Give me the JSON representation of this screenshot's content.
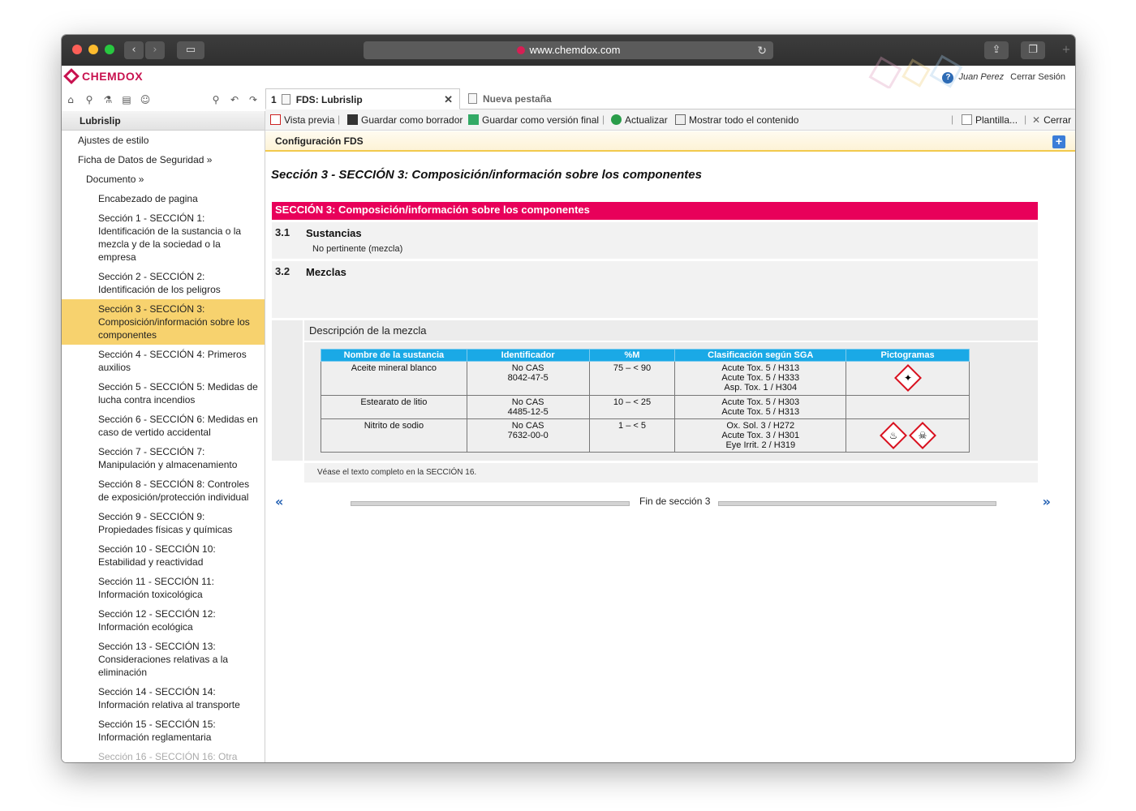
{
  "browser": {
    "url": "www.chemdox.com"
  },
  "app": {
    "logo": "CHEMDOX",
    "user": "Juan Perez",
    "logout": "Cerrar Sesión"
  },
  "tabs": [
    {
      "num": "1",
      "label": "FDS: Lubrislip",
      "close": "✕"
    },
    {
      "label": "Nueva pestaña"
    }
  ],
  "sidebar": {
    "title": "Lubrislip",
    "items": [
      "Ajustes de estilo",
      "Ficha de Datos de Seguridad »",
      "Documento »",
      "Encabezado de pagina",
      "Sección 1 - SECCIÓN 1: Identificación de la sustancia o la mezcla y de la sociedad o la empresa",
      "Sección 2 - SECCIÓN 2: Identificación de los peligros",
      "Sección 3 - SECCIÓN 3: Composición/información sobre los componentes",
      "Sección 4 - SECCIÓN 4: Primeros auxilios",
      "Sección 5 - SECCIÓN 5: Medidas de lucha contra incendios",
      "Sección 6 - SECCIÓN 6: Medidas en caso de vertido accidental",
      "Sección 7 - SECCIÓN 7: Manipulación y almacenamiento",
      "Sección 8 - SECCIÓN 8: Controles de exposición/protección individual",
      "Sección 9 - SECCIÓN 9: Propiedades físicas y químicas",
      "Sección 10 - SECCIÓN 10: Estabilidad y reactividad",
      "Sección 11 - SECCIÓN 11: Información toxicológica",
      "Sección 12 - SECCIÓN 12: Información ecológica",
      "Sección 13 - SECCIÓN 13: Consideraciones relativas a la eliminación",
      "Sección 14 - SECCIÓN 14: Información relativa al transporte",
      "Sección 15 - SECCIÓN 15: Información reglamentaria",
      "Sección 16 - SECCIÓN 16: Otra"
    ]
  },
  "toolbar": {
    "preview": "Vista previa",
    "save_draft": "Guardar como borrador",
    "save_final": "Guardar como versión final",
    "refresh": "Actualizar",
    "show_all": "Mostrar todo el contenido",
    "template": "Plantilla...",
    "close": "Cerrar"
  },
  "config": {
    "title": "Configuración FDS",
    "plus": "+"
  },
  "content": {
    "page_title": "Sección 3 - SECCIÓN 3: Composición/información sobre los componentes",
    "section_header": "SECCIÓN 3: Composición/información sobre los componentes",
    "sub1": {
      "num": "3.1",
      "title": "Sustancias",
      "text": "No pertinente (mezcla)"
    },
    "sub2": {
      "num": "3.2",
      "title": "Mezclas"
    },
    "mix_desc": "Descripción de la mezcla",
    "table": {
      "headers": [
        "Nombre de la sustancia",
        "Identificador",
        "%M",
        "Clasificación según SGA",
        "Pictogramas"
      ],
      "rows": [
        {
          "name": "Aceite mineral blanco",
          "id1": "No CAS",
          "id2": "8042-47-5",
          "pct": "75 – < 90",
          "cls1": "Acute Tox. 5 / H313",
          "cls2": "Acute Tox. 5 / H333",
          "cls3": "Asp. Tox. 1 / H304",
          "pictos": [
            "health-hazard"
          ]
        },
        {
          "name": "Estearato de litio",
          "id1": "No CAS",
          "id2": "4485-12-5",
          "pct": "10 – < 25",
          "cls1": "Acute Tox. 5 / H303",
          "cls2": "Acute Tox. 5 / H313",
          "cls3": "",
          "pictos": []
        },
        {
          "name": "Nitrito de sodio",
          "id1": "No CAS",
          "id2": "7632-00-0",
          "pct": "1 – < 5",
          "cls1": "Ox. Sol. 3 / H272",
          "cls2": "Acute Tox. 3 / H301",
          "cls3": "Eye Irrit. 2 / H319",
          "pictos": [
            "flame-over-circle",
            "skull-crossbones"
          ]
        }
      ]
    },
    "note": "Véase el texto completo en la SECCIÓN 16.",
    "end_label": "Fin de sección 3",
    "prev": "«",
    "next": "»"
  },
  "colors": {
    "section_header": "#e8005a",
    "table_header": "#1aa9e6",
    "active_nav": "#f7d26e",
    "logo": "#c8124f"
  }
}
